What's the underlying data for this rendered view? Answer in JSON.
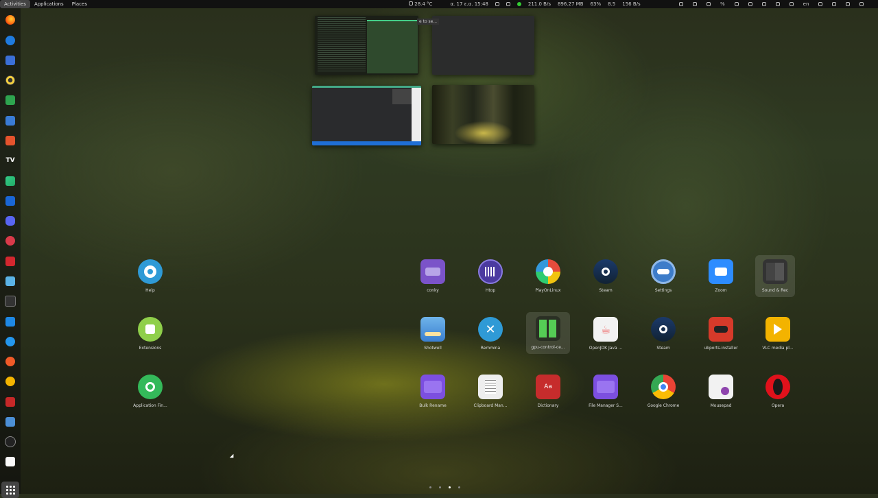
{
  "topbar": {
    "activities": "Activities",
    "applications": "Applications",
    "places": "Places",
    "temperature": "28.4 °C",
    "datetime": "α. 17 ε.α. 15:48",
    "net_speed": "211.0 B/s",
    "memory": "896.27 MB",
    "cpu": "63%",
    "load": "8.5",
    "upload": "156 B/s",
    "percent_indicator": "%",
    "keyboard_layout": "en"
  },
  "workspaces": {
    "tooltip": "e to se..."
  },
  "apps_row1": [
    {
      "label": "Help",
      "icon": "lifebuoy-icon"
    },
    {
      "label": "conky",
      "icon": "conky-icon"
    },
    {
      "label": "Htop",
      "icon": "htop-icon"
    },
    {
      "label": "PlayOnLinux",
      "icon": "playonlinux-icon"
    },
    {
      "label": "Steam",
      "icon": "steam-icon"
    },
    {
      "label": "Settings",
      "icon": "settings-toggle-icon"
    },
    {
      "label": "Zoom",
      "icon": "zoom-camera-icon"
    },
    {
      "label": "Sound & Rec",
      "icon": "sound-folder-icon"
    }
  ],
  "apps_row2": [
    {
      "label": "Extensions",
      "icon": "puzzle-icon"
    },
    {
      "label": "Shotwell",
      "icon": "shotwell-icon"
    },
    {
      "label": "Remmina",
      "icon": "remmina-icon"
    },
    {
      "label": "gpu-control-ce...",
      "icon": "gpu-control-icon"
    },
    {
      "label": "OpenJDK Java ...",
      "icon": "java-icon"
    },
    {
      "label": "Steam",
      "icon": "steam-icon"
    },
    {
      "label": "ubports-installer",
      "icon": "ubports-robot-icon"
    },
    {
      "label": "VLC media pl...",
      "icon": "vlc-icon"
    }
  ],
  "apps_row3": [
    {
      "label": "Application Fin...",
      "icon": "magnifier-icon"
    },
    {
      "label": "Bulk Rename",
      "icon": "folder-purple-icon"
    },
    {
      "label": "Clipboard Man...",
      "icon": "clipboard-icon"
    },
    {
      "label": "Dictionary",
      "icon": "dictionary-book-icon"
    },
    {
      "label": "File Manager S...",
      "icon": "folder-purple-icon"
    },
    {
      "label": "Google Chrome",
      "icon": "chrome-icon"
    },
    {
      "label": "Mousepad",
      "icon": "mousepad-icon"
    },
    {
      "label": "Opera",
      "icon": "opera-icon"
    }
  ],
  "colors": {
    "accent": "#3584e4",
    "dock_bg": "#111111"
  }
}
